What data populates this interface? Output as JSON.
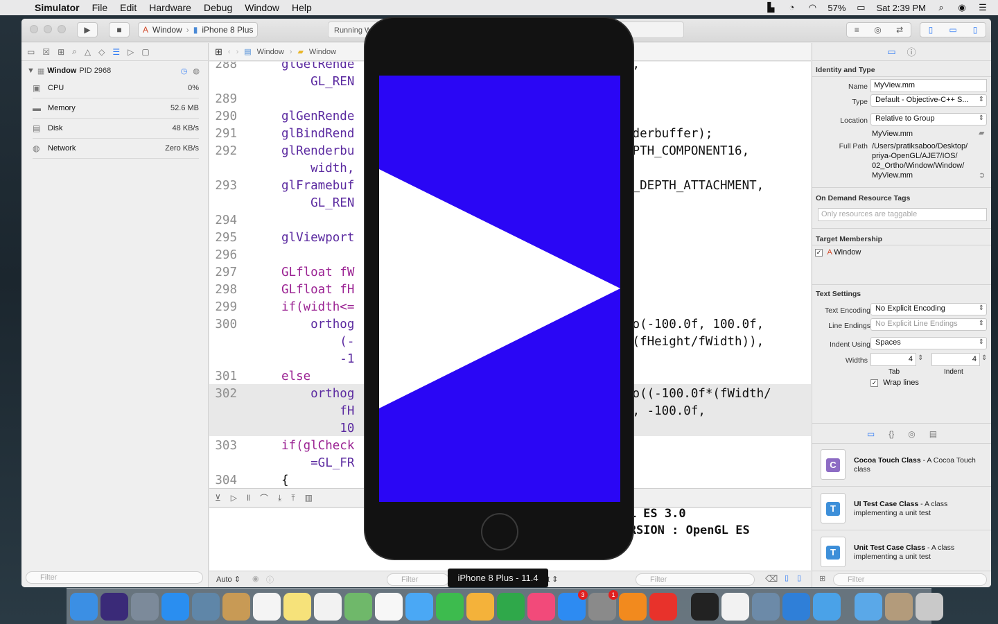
{
  "menubar": {
    "apple": "",
    "items": [
      "Simulator",
      "File",
      "Edit",
      "Hardware",
      "Debug",
      "Window",
      "Help"
    ],
    "battery": "57%",
    "clock": "Sat 2:39 PM"
  },
  "toolbar": {
    "scheme_target": "Window",
    "scheme_device": "iPhone 8 Plus",
    "activity": "Running W"
  },
  "navigator": {
    "process_name": "Window",
    "process_pid": "PID 2968",
    "gauges": [
      {
        "name": "CPU",
        "value": "0%"
      },
      {
        "name": "Memory",
        "value": "52.6 MB"
      },
      {
        "name": "Disk",
        "value": "48 KB/s"
      },
      {
        "name": "Network",
        "value": "Zero KB/s"
      }
    ],
    "filter_placeholder": "Filter"
  },
  "jumpbar": {
    "crumb1": "Window",
    "crumb2": "Window"
  },
  "code_lines": [
    {
      "ln": "288",
      "text": "glGetRende",
      "right": "R,"
    },
    {
      "ln": "",
      "text": "    GL_REN",
      "right": ""
    },
    {
      "ln": "289",
      "text": "",
      "right": ""
    },
    {
      "ln": "290",
      "text": "glGenRende",
      "right": ""
    },
    {
      "ln": "291",
      "text": "glBindRend",
      "right": "nderbuffer);"
    },
    {
      "ln": "292",
      "text": "glRenderbu",
      "right": "EPTH_COMPONENT16,"
    },
    {
      "ln": "",
      "text": "    width,",
      "right": ""
    },
    {
      "ln": "293",
      "text": "glFramebuf",
      "right": "L_DEPTH_ATTACHMENT,"
    },
    {
      "ln": "",
      "text": "    GL_REN",
      "right": ""
    },
    {
      "ln": "294",
      "text": "",
      "right": ""
    },
    {
      "ln": "295",
      "text": "glViewport",
      "right": ""
    },
    {
      "ln": "296",
      "text": "",
      "right": ""
    },
    {
      "ln": "297",
      "text": "GLfloat fW",
      "right": ""
    },
    {
      "ln": "298",
      "text": "GLfloat fH",
      "right": ""
    },
    {
      "ln": "299",
      "text": "if(width<=",
      "right": ""
    },
    {
      "ln": "300",
      "text": "    orthog",
      "right": "ho(-100.0f, 100.0f,"
    },
    {
      "ln": "",
      "text": "        (-",
      "right": "*(fHeight/fWidth)),"
    },
    {
      "ln": "",
      "text": "        -1",
      "right": ""
    },
    {
      "ln": "301",
      "text": "else",
      "right": ""
    },
    {
      "ln": "302",
      "text": "    orthog",
      "right": "ho((-100.0f*(fWidth/"
    },
    {
      "ln": "",
      "text": "        fH",
      "right": "), -100.0f,"
    },
    {
      "ln": "",
      "text": "        10",
      "right": ""
    },
    {
      "ln": "303",
      "text": "if(glCheck",
      "right": "!"
    },
    {
      "ln": "",
      "text": "    =GL_FR",
      "right": ""
    },
    {
      "ln": "304",
      "text": "{",
      "right": ""
    }
  ],
  "console": {
    "line1": "enGL ES 3.0",
    "line2": "_VERSION : OpenGL ES"
  },
  "editor_bottom": {
    "auto": "Auto",
    "filter1": "Filter",
    "filter2": "Filter",
    "frag": "t"
  },
  "inspector": {
    "identity_title": "Identity and Type",
    "name_label": "Name",
    "name_value": "MyView.mm",
    "type_label": "Type",
    "type_value": "Default - Objective-C++ S...",
    "location_label": "Location",
    "location_value": "Relative to Group",
    "location_file": "MyView.mm",
    "fullpath_label": "Full Path",
    "fullpath_value": "/Users/pratiksaboo/Desktop/ priya-OpenGL/AJE7/IOS/ 02_Ortho/Window/Window/ MyView.mm",
    "ondemand_title": "On Demand Resource Tags",
    "ondemand_placeholder": "Only resources are taggable",
    "target_title": "Target Membership",
    "target_name": "Window",
    "text_settings_title": "Text Settings",
    "encoding_label": "Text Encoding",
    "encoding_value": "No Explicit Encoding",
    "endings_label": "Line Endings",
    "endings_value": "No Explicit Line Endings",
    "indent_label": "Indent Using",
    "indent_value": "Spaces",
    "widths_label": "Widths",
    "tab_value": "4",
    "indent_width_value": "4",
    "tab_caption": "Tab",
    "indent_caption": "Indent",
    "wrap_label": "Wrap lines",
    "library": [
      {
        "title": "Cocoa Touch Class",
        "desc": " - A Cocoa Touch class",
        "letter": "C",
        "color": "#8d6cc4"
      },
      {
        "title": "UI Test Case Class",
        "desc": " - A class implementing a unit test",
        "letter": "T",
        "color": "#3d8fd9"
      },
      {
        "title": "Unit Test Case Class",
        "desc": " - A class implementing a unit test",
        "letter": "T",
        "color": "#3d8fd9"
      }
    ],
    "filter_placeholder": "Filter"
  },
  "simulator": {
    "device_label": "iPhone 8 Plus - 11.4",
    "screen_color": "#2a06f5",
    "triangle_color": "#ffffff"
  },
  "dock": {
    "apps": [
      {
        "name": "finder-icon",
        "color": "#3b8fe4"
      },
      {
        "name": "siri-icon",
        "color": "#3a2a78"
      },
      {
        "name": "launchpad-icon",
        "color": "#7c8a9a"
      },
      {
        "name": "safari-icon",
        "color": "#2a8ef0"
      },
      {
        "name": "mail-bird-icon",
        "color": "#5f86a8"
      },
      {
        "name": "contacts-icon",
        "color": "#c89a55"
      },
      {
        "name": "calendar-icon",
        "color": "#f4f4f4"
      },
      {
        "name": "notes-icon",
        "color": "#f6e27a"
      },
      {
        "name": "reminders-icon",
        "color": "#f2f2f2"
      },
      {
        "name": "maps-icon",
        "color": "#6fb86a"
      },
      {
        "name": "photos-icon",
        "color": "#f7f7f7"
      },
      {
        "name": "messages-icon",
        "color": "#4aa8f5"
      },
      {
        "name": "facetime-icon",
        "color": "#3dbb4e"
      },
      {
        "name": "keynote-icon",
        "color": "#f4b23a"
      },
      {
        "name": "numbers-icon",
        "color": "#2fa84a"
      },
      {
        "name": "itunes-icon",
        "color": "#f24a7a"
      },
      {
        "name": "app-store-icon",
        "color": "#2d8bf2",
        "badge": "3"
      },
      {
        "name": "system-preferences-icon",
        "color": "#8a8a8a",
        "badge": "1"
      },
      {
        "name": "ibooks-icon",
        "color": "#f28a1e"
      },
      {
        "name": "anydesk-icon",
        "color": "#e8322b"
      }
    ],
    "apps2": [
      {
        "name": "terminal-icon",
        "color": "#222222"
      },
      {
        "name": "textedit-icon",
        "color": "#f2f2f2"
      },
      {
        "name": "preview-icon",
        "color": "#6c8aa8"
      },
      {
        "name": "xcode-icon",
        "color": "#2f7fd8"
      },
      {
        "name": "xcode-beta-icon",
        "color": "#4aa2e8"
      }
    ],
    "apps3": [
      {
        "name": "downloads-folder-icon",
        "color": "#5aa8e8"
      },
      {
        "name": "documents-stack-icon",
        "color": "#b39b7b"
      },
      {
        "name": "trash-icon",
        "color": "#c9c9c9"
      }
    ]
  }
}
